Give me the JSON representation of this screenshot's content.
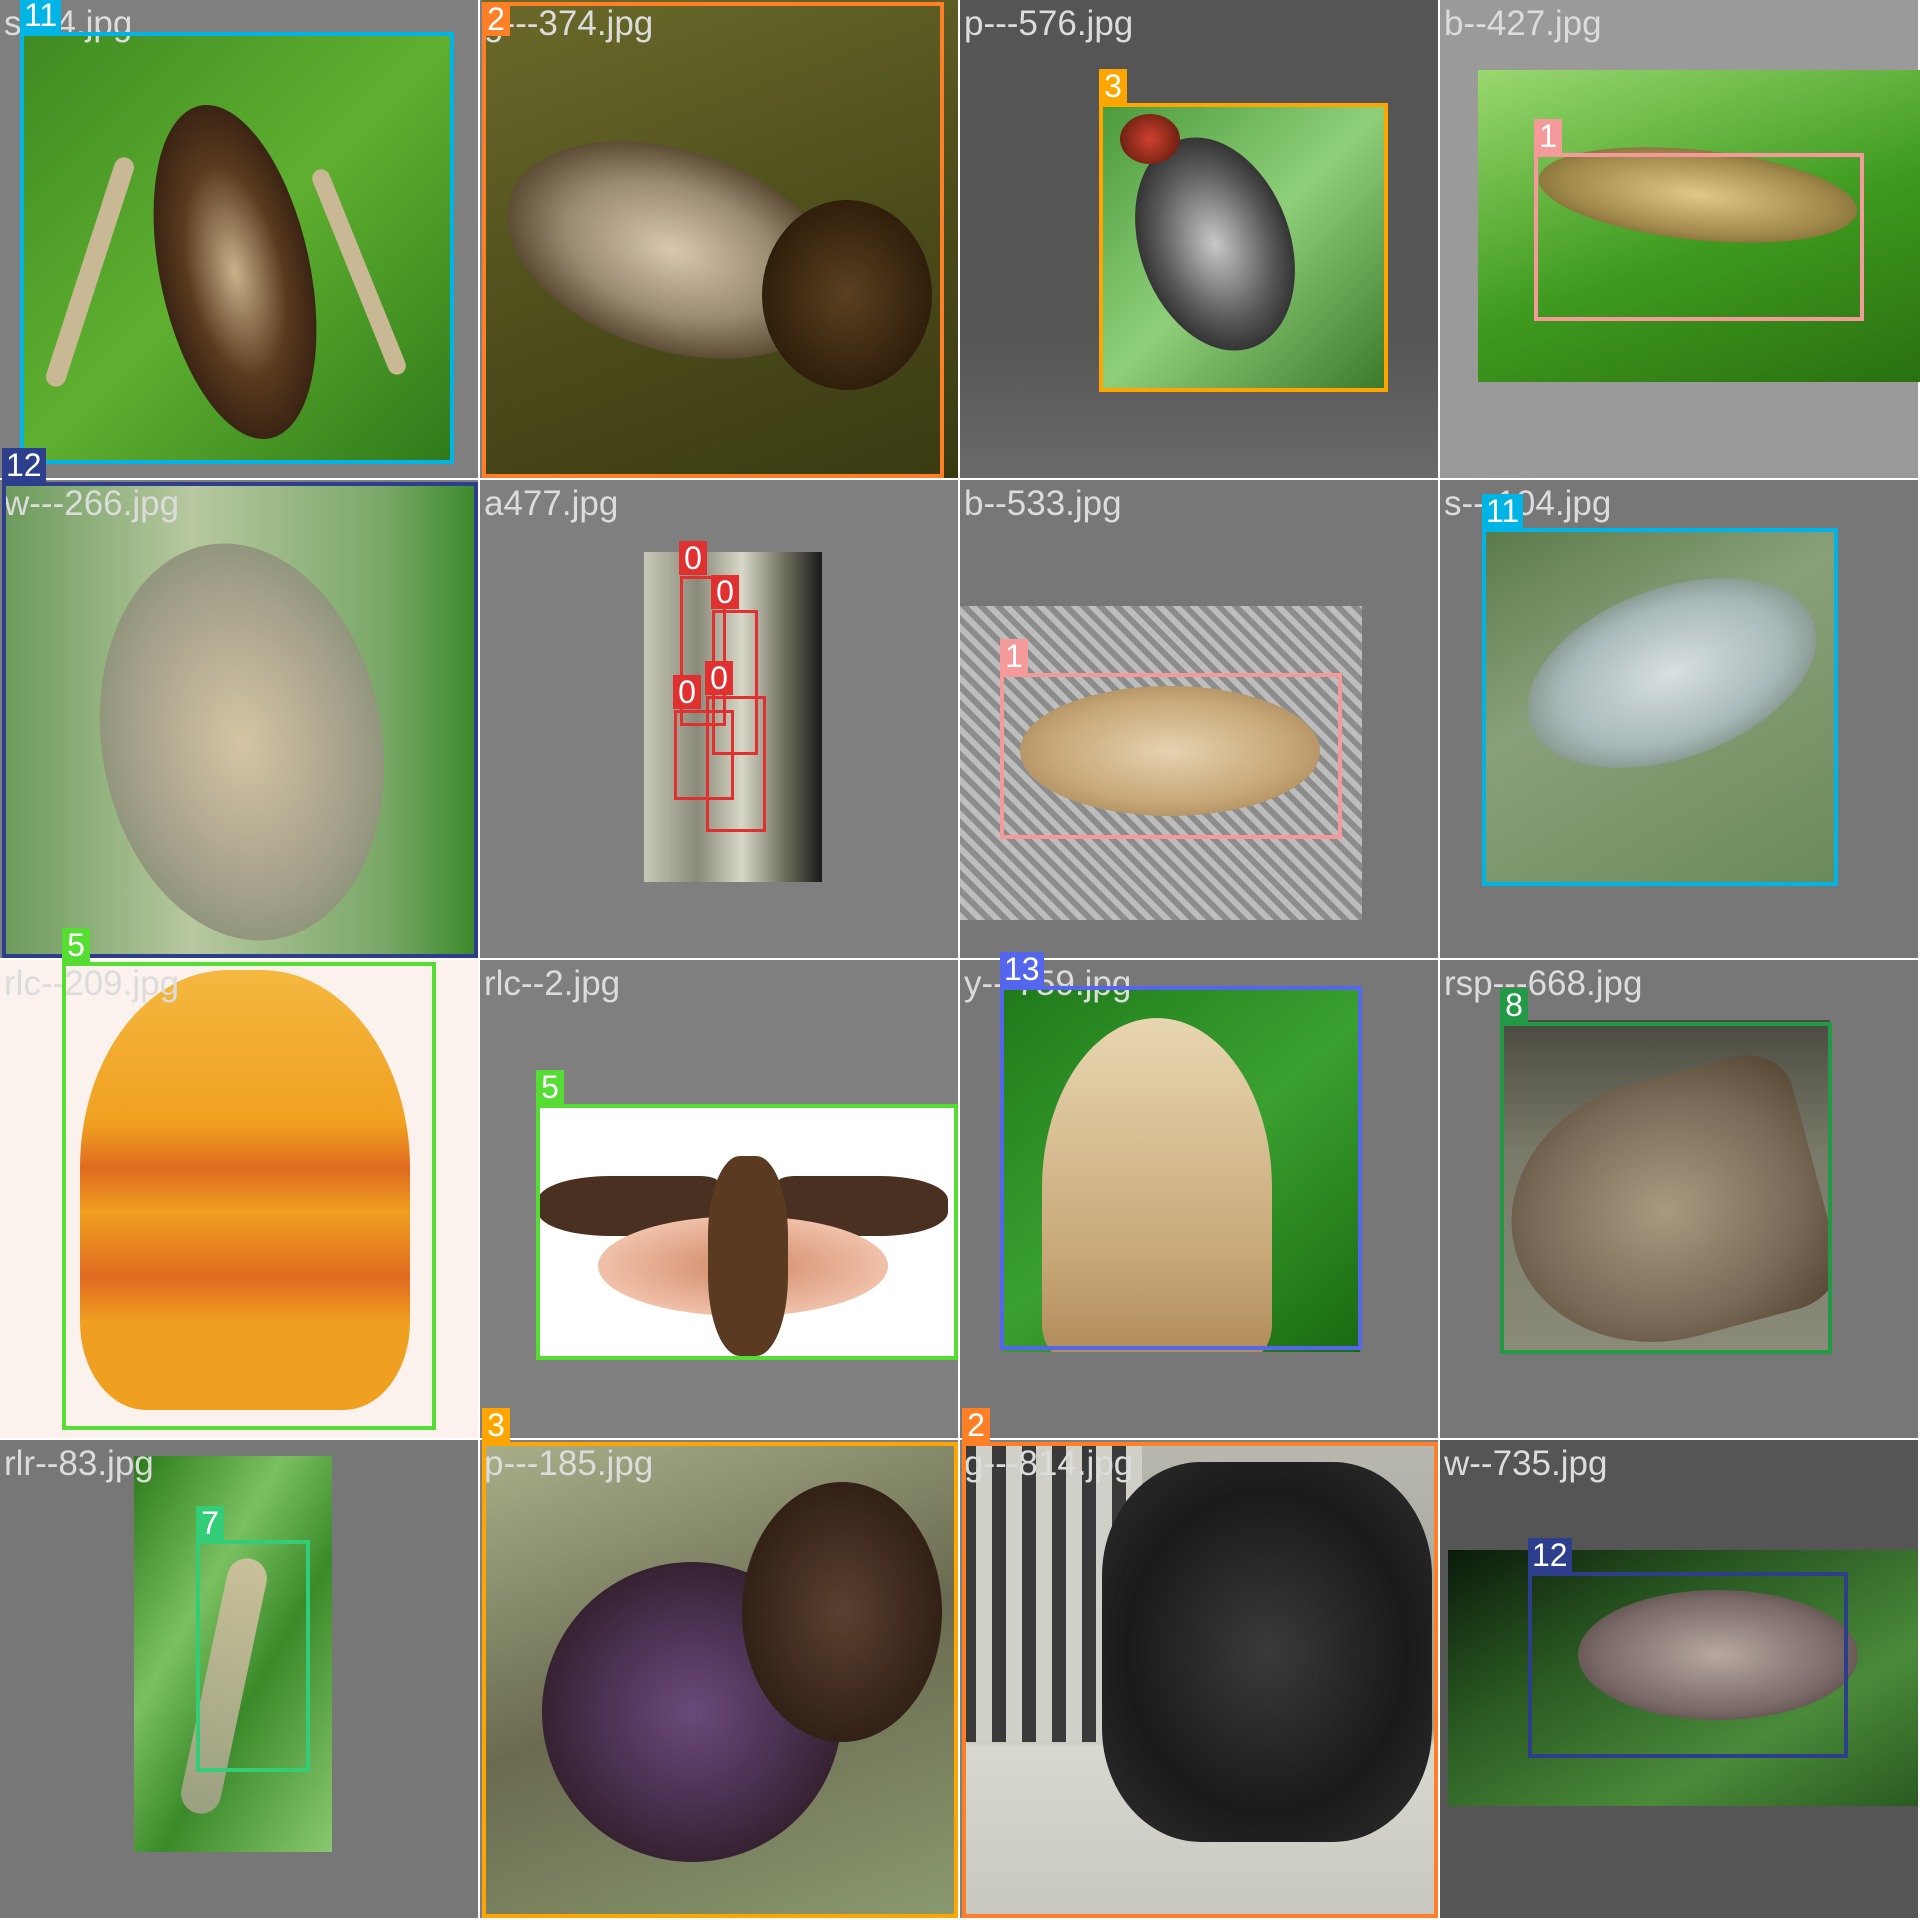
{
  "tiles": [
    {
      "file": "s---4.jpg",
      "label": "11",
      "color": "#00b4e6",
      "bg": "#7f7f7f"
    },
    {
      "file": "g---374.jpg",
      "label": "2",
      "color": "#ff7f27",
      "bg": "#7f7f7f"
    },
    {
      "file": "p---576.jpg",
      "label": "3",
      "color": "#ffa500",
      "bg": "#555555"
    },
    {
      "file": "b--427.jpg",
      "label": "1",
      "color": "#f49a9a",
      "bg": "#9a9a9a"
    },
    {
      "file": "w---266.jpg",
      "label": "12",
      "color": "#2c3e8c",
      "bg": "#7f7f7f"
    },
    {
      "file": "a477.jpg",
      "labels": [
        "0",
        "0",
        "0",
        "0"
      ],
      "color": "#e03030",
      "bg": "#7f7f7f"
    },
    {
      "file": "b--533.jpg",
      "label": "1",
      "color": "#f49a9a",
      "bg": "#777777"
    },
    {
      "file": "s---104.jpg",
      "label": "11",
      "color": "#00b4e6",
      "bg": "#777777"
    },
    {
      "file": "rlc--209.jpg",
      "label": "5",
      "color": "#55dd33",
      "bg": "#7f7f7f"
    },
    {
      "file": "rlc--2.jpg",
      "label": "5",
      "color": "#55dd33",
      "bg": "#7f7f7f"
    },
    {
      "file": "y---759.jpg",
      "label": "13",
      "color": "#5566ee",
      "bg": "#777777"
    },
    {
      "file": "rsp---668.jpg",
      "label": "8",
      "color": "#229944",
      "bg": "#777777"
    },
    {
      "file": "rlr--83.jpg",
      "label": "7",
      "color": "#33cc77",
      "bg": "#777777"
    },
    {
      "file": "p---185.jpg",
      "label": "3",
      "color": "#ffa500",
      "bg": "#7f7f7f"
    },
    {
      "file": "g---814.jpg",
      "label": "2",
      "color": "#ff7f27",
      "bg": "#7f7f7f"
    },
    {
      "file": "w--735.jpg",
      "label": "12",
      "color": "#2c3e8c",
      "bg": "#555555"
    }
  ]
}
